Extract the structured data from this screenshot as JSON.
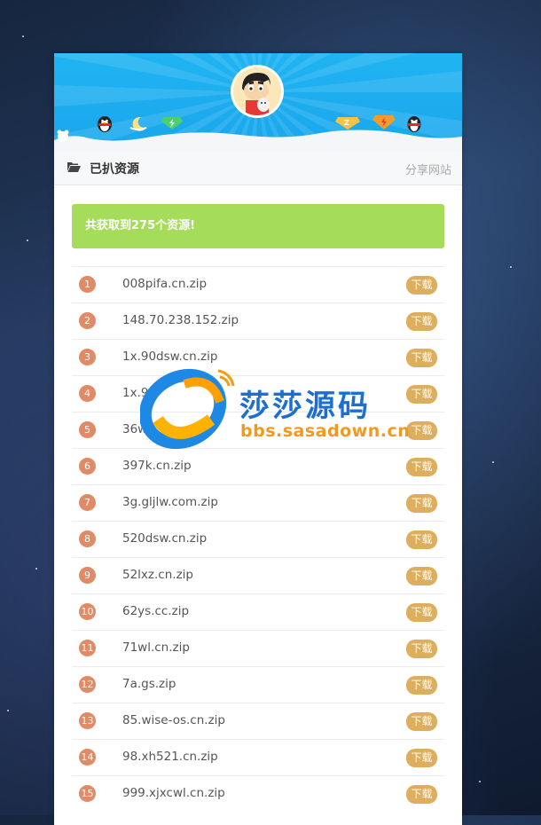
{
  "header": {
    "title": "已扒资源",
    "share_link": "分享网站"
  },
  "alert": {
    "message": "共获取到275个资源!"
  },
  "resources": [
    {
      "num": "1",
      "name": "008pifa.cn.zip",
      "action": "下载"
    },
    {
      "num": "2",
      "name": "148.70.238.152.zip",
      "action": "下载"
    },
    {
      "num": "3",
      "name": "1x.90dsw.cn.zip",
      "action": "下载"
    },
    {
      "num": "4",
      "name": "1x.9",
      "action": "下载"
    },
    {
      "num": "5",
      "name": "36w",
      "action": "下载"
    },
    {
      "num": "6",
      "name": "397k.cn.zip",
      "action": "下载"
    },
    {
      "num": "7",
      "name": "3g.gljlw.com.zip",
      "action": "下载"
    },
    {
      "num": "8",
      "name": "520dsw.cn.zip",
      "action": "下载"
    },
    {
      "num": "9",
      "name": "52lxz.cn.zip",
      "action": "下载"
    },
    {
      "num": "10",
      "name": "62ys.cc.zip",
      "action": "下载"
    },
    {
      "num": "11",
      "name": "71wl.cn.zip",
      "action": "下载"
    },
    {
      "num": "12",
      "name": "7a.gs.zip",
      "action": "下载"
    },
    {
      "num": "13",
      "name": "85.wise-os.cn.zip",
      "action": "下载"
    },
    {
      "num": "14",
      "name": "98.xh521.cn.zip",
      "action": "下载"
    },
    {
      "num": "15",
      "name": "999.xjxcwl.cn.zip",
      "action": "下载"
    }
  ],
  "watermark": {
    "brand": "莎莎源码",
    "url": "bbs.sasadown.cn"
  },
  "colors": {
    "banner": "#1aa6ec",
    "alert": "#a5dc5a",
    "number_badge": "#e08a66",
    "download_button": "#dcae5d"
  },
  "icons": {
    "folder": "folder-open-icon",
    "left_deco": [
      "qq-penguin-icon",
      "moon-icon",
      "lightning-diamond-icon"
    ],
    "right_deco": [
      "svip-diamond-icon",
      "lightning-diamond-icon",
      "qq-penguin-icon"
    ]
  }
}
